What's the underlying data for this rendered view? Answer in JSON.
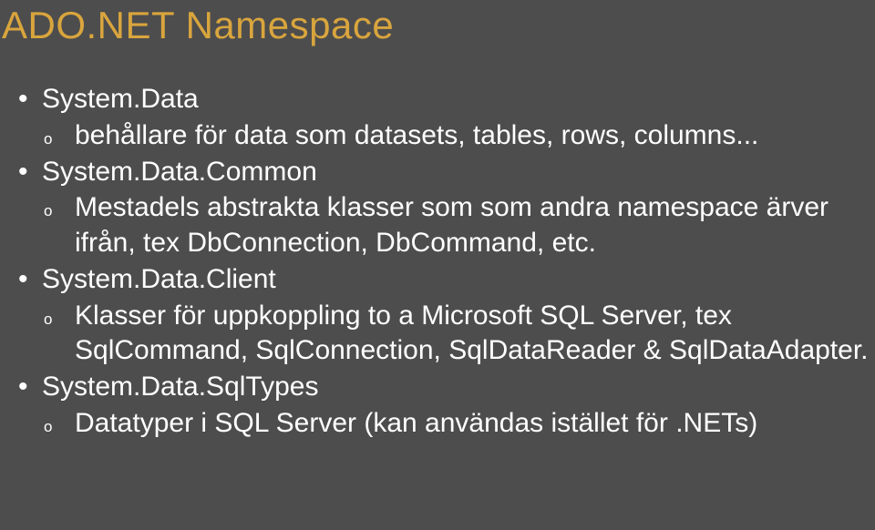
{
  "title": "ADO.NET Namespace",
  "items": [
    {
      "label": "System.Data",
      "subs": [
        "behållare för data som datasets, tables, rows, columns..."
      ]
    },
    {
      "label": "System.Data.Common",
      "subs": [
        "Mestadels abstrakta klasser som som andra namespace ärver ifrån, tex DbConnection, DbCommand, etc."
      ]
    },
    {
      "label": "System.Data.Client",
      "subs": [
        "Klasser för uppkoppling to a Microsoft SQL Server, tex SqlCommand, SqlConnection, SqlDataReader & SqlDataAdapter."
      ]
    },
    {
      "label": "System.Data.SqlTypes",
      "subs": [
        "Datatyper i SQL Server (kan användas istället för .NETs)"
      ]
    }
  ]
}
